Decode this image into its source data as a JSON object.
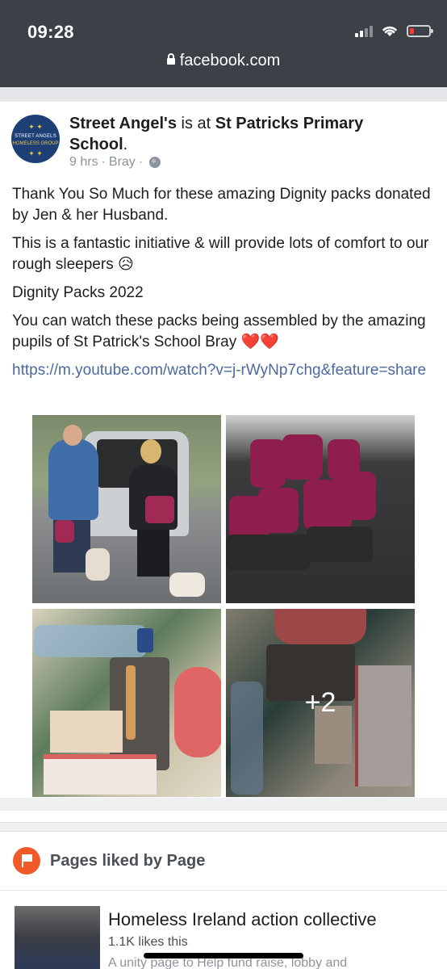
{
  "status_bar": {
    "time": "09:28"
  },
  "browser": {
    "url": "facebook.com"
  },
  "post": {
    "avatar_text": {
      "line1": "STREET ANGELS",
      "line2": "HOMELESS GROUP"
    },
    "author": "Street Angel's",
    "is_at": " is at ",
    "location": "St Patricks Primary School",
    "period": ".",
    "time_ago": "9 hrs",
    "place": "Bray",
    "dot": "·",
    "paragraphs": [
      "Thank You So Much for these amazing Dignity packs donated by Jen & her Husband.",
      "This is a fantastic initiative & will provide lots of comfort to our rough sleepers 😥",
      "Dignity Packs 2022",
      "You can watch these packs being assembled by the amazing pupils of St Patrick's School Bray ❤️❤️"
    ],
    "link": "https://m.youtube.com/watch?v=j-rWyNp7chg&feature=share",
    "more_photos": "+2"
  },
  "pages_liked": {
    "title": "Pages liked by Page",
    "items": [
      {
        "name": "Homeless Ireland action collective",
        "likes": "1.1K likes this",
        "description": "A unity page to Help fund raise, lobby and"
      }
    ]
  },
  "colors": {
    "status_bar": "#3b4147",
    "link": "#4b68a0",
    "accent": "#f05a28"
  }
}
